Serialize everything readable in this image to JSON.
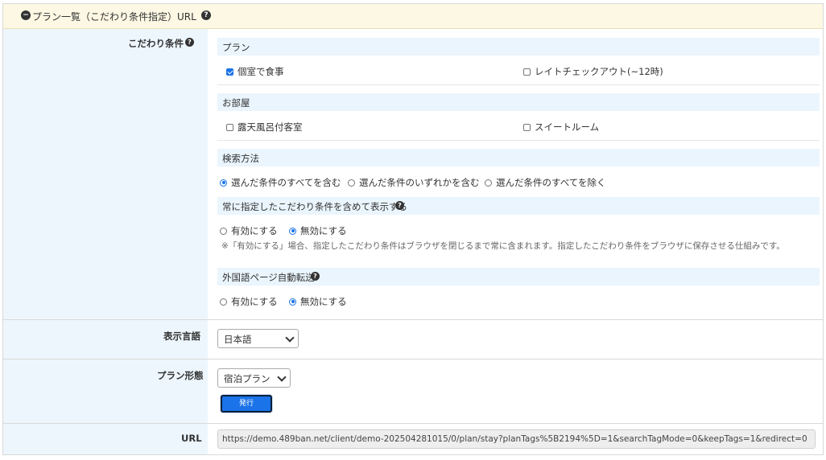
{
  "header": {
    "title": "プラン一覧（こだわり条件指定）URL"
  },
  "kodawari": {
    "label": "こだわり条件",
    "sections": {
      "plan": {
        "title": "プラン",
        "options": [
          {
            "label": "個室で食事",
            "checked": true
          },
          {
            "label": "レイトチェックアウト(~12時)",
            "checked": false
          }
        ]
      },
      "room": {
        "title": "お部屋",
        "options": [
          {
            "label": "露天風呂付客室",
            "checked": false
          },
          {
            "label": "スイートルーム",
            "checked": false
          }
        ]
      },
      "search_method": {
        "title": "検索方法",
        "options": [
          {
            "label": "選んだ条件のすべてを含む",
            "selected": true
          },
          {
            "label": "選んだ条件のいずれかを含む",
            "selected": false
          },
          {
            "label": "選んだ条件のすべてを除く",
            "selected": false
          }
        ]
      },
      "keep_tags": {
        "title": "常に指定したこだわり条件を含めて表示する",
        "options": [
          {
            "label": "有効にする",
            "selected": false
          },
          {
            "label": "無効にする",
            "selected": true
          }
        ],
        "note": "※「有効にする」場合、指定したこだわり条件はブラウザを閉じるまで常に含まれます。指定したこだわり条件をブラウザに保存させる仕組みです。"
      },
      "redirect": {
        "title": "外国語ページ自動転送",
        "options": [
          {
            "label": "有効にする",
            "selected": false
          },
          {
            "label": "無効にする",
            "selected": true
          }
        ]
      }
    }
  },
  "language": {
    "label": "表示言語",
    "selected": "日本語"
  },
  "plan_type": {
    "label": "プラン形態",
    "selected": "宿泊プラン",
    "button_label": "発行"
  },
  "url": {
    "label": "URL",
    "value": "https://demo.489ban.net/client/demo-202504281015/0/plan/stay?planTags%5B2194%5D=1&searchTagMode=0&keepTags=1&redirect=0"
  },
  "colors": {
    "accent": "#1a73e8",
    "header_bg": "#fcf8e3",
    "label_bg": "#edf6fd",
    "band_bg": "#eaf5fd"
  }
}
